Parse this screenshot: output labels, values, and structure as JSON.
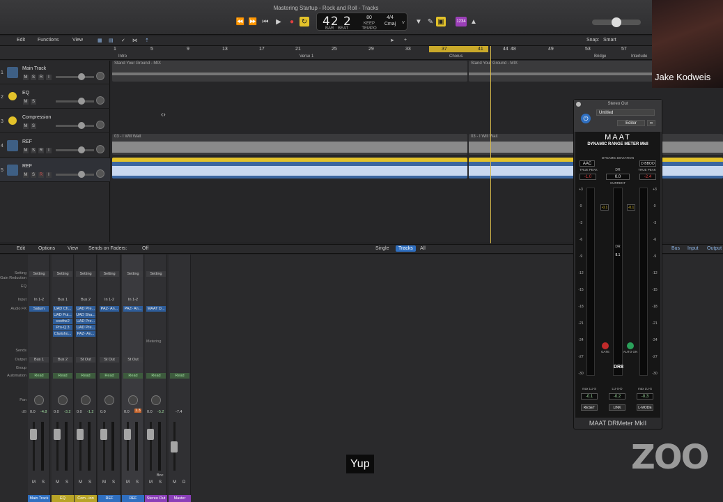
{
  "window": {
    "title": "Mastering Startup - Rock and Roll - Tracks"
  },
  "transport": {
    "bar": "42",
    "beat": "2",
    "bar_label": "BAR",
    "beat_label": "BEAT",
    "tempo": "80",
    "tempo_label": "KEEP",
    "tempo_sub": "TEMPO",
    "sig": "4/4",
    "key": "Cmaj",
    "count_in": "1234"
  },
  "toolbar": {
    "edit": "Edit",
    "functions": "Functions",
    "view": "View",
    "snap_label": "Snap:",
    "snap_value": "Smart"
  },
  "ruler": {
    "bars": [
      "1",
      "5",
      "9",
      "13",
      "17",
      "21",
      "25",
      "29",
      "33",
      "37",
      "41",
      "45",
      "49",
      "53",
      "57"
    ],
    "cycle_start": "37",
    "cycle_end": "41",
    "cycle_extra": "44",
    "cycle_extra2": "48",
    "markers": [
      "Intro",
      "Verse 1",
      "Chorus",
      "Bridge",
      "Interlude"
    ]
  },
  "tracks": [
    {
      "num": "1",
      "name": "Main Track",
      "buttons": [
        "M",
        "S",
        "R",
        "I"
      ]
    },
    {
      "num": "2",
      "name": "EQ",
      "buttons": [
        "M",
        "S"
      ]
    },
    {
      "num": "3",
      "name": "Compression",
      "buttons": [
        "M",
        "S"
      ]
    },
    {
      "num": "4",
      "name": "REF",
      "buttons": [
        "M",
        "S",
        "R",
        "I"
      ]
    },
    {
      "num": "5",
      "name": "REF",
      "buttons": [
        "M",
        "S",
        "R",
        "I"
      ]
    }
  ],
  "regions": {
    "main_a": "Stand Your Ground - MIX",
    "main_b": "Stand Your Ground - MIX",
    "ref4_a": "03 - I Will Wait",
    "ref4_b": "03 - I Will Wait",
    "ref5_a": "Stand Your Ground - MIX.1",
    "ref5_b": "Stand Your Ground - MIX.1"
  },
  "mixer_bar": {
    "edit": "Edit",
    "options": "Options",
    "view": "View",
    "sends_label": "Sends on Faders:",
    "sends_value": "Off",
    "single": "Single",
    "tracks": "Tracks",
    "all": "All",
    "bus": "Bus",
    "input": "Input",
    "output": "Output"
  },
  "mixer_labels": {
    "setting": "Setting",
    "gain": "Gain Reduction",
    "eq": "EQ",
    "input": "Input",
    "fx": "Audio FX",
    "sends": "Sends",
    "output": "Output",
    "group": "Group",
    "automation": "Automation",
    "pan": "Pan",
    "db": "dB"
  },
  "strips": [
    {
      "name": "Main Track",
      "color": "#2f6fc0",
      "input": "In 1-2",
      "fx": [
        "Saturn"
      ],
      "output": "Bus 1",
      "db1": "0.0",
      "db2": "-4.8",
      "setting": "Setting"
    },
    {
      "name": "EQ",
      "color": "#b8a427",
      "input": "Bus 1",
      "fx": [
        "UAD Ch...",
        "UAD Pul...",
        "soothe2",
        "Pro-Q 3",
        "Clarisho..."
      ],
      "output": "Bus 2",
      "db1": "0.0",
      "db2": "-3.2",
      "setting": "Setting"
    },
    {
      "name": "Com...ion",
      "color": "#b8a427",
      "input": "Bus 2",
      "fx": [
        "UAD Pre...",
        "UAD Sha...",
        "UAD Pre...",
        "UAD Pre...",
        "PAZ- An..."
      ],
      "output": "St Out",
      "db1": "0.0",
      "db2": "-1.2",
      "setting": "Setting"
    },
    {
      "name": "REF",
      "color": "#2f6fc0",
      "input": "In 1-2",
      "fx": [
        "PAZ- An..."
      ],
      "output": "St Out",
      "db1": "0.0",
      "db2": "",
      "setting": "Setting"
    },
    {
      "name": "REF",
      "color": "#2f6fc0",
      "input": "In 1-2",
      "fx": [
        "PAZ- An..."
      ],
      "output": "St Out",
      "db1": "0.0",
      "db2": "1.3",
      "setting": "Setting"
    },
    {
      "name": "Stereo Out",
      "color": "#8a3fb8",
      "input": "",
      "fx": [
        "MAAT D..."
      ],
      "output": "",
      "db1": "0.0",
      "db2": "-5.2",
      "setting": "Setting",
      "extra": "Metering",
      "bnc": "Bnc"
    },
    {
      "name": "Master",
      "color": "#8a3fb8",
      "input": "",
      "fx": [],
      "output": "",
      "db1": "-7.4",
      "db2": "",
      "setting": ""
    }
  ],
  "plugin": {
    "window_title": "Stereo Out",
    "preset": "Untitled",
    "editor": "Editor",
    "brand": "MAAT",
    "product": "DYNAMIC RANGE METER MkII",
    "dyn_dev": "DYNAMIC DEVIATION",
    "aac": "AAC",
    "dr_label": "DR",
    "dr_value": "0.0",
    "dbo": "D BBOO",
    "true_peak_l": "TRUE PEAK",
    "true_peak_r": "TRUE PEAK",
    "peak_l": "-1.0",
    "peak_r": "-2.4",
    "current": "CURRENT",
    "scale": [
      "+3",
      "0",
      "-3",
      "-6",
      "-9",
      "-12",
      "-15",
      "-18",
      "-21",
      "-24",
      "-27",
      "-30"
    ],
    "scale_r": [
      "+3",
      "0",
      "-3",
      "-6",
      "-9",
      "-12",
      "-15",
      "-18",
      "-21",
      "-24",
      "-27",
      "-30"
    ],
    "top_l": "-0.1",
    "top_r": "-0.1",
    "dr_meter": "DR",
    "dr_read": "8.1",
    "gate": "GATE",
    "auto": "AUTO ON",
    "dr8": "DR8",
    "max_lu_l": "max LU-S",
    "max_lu_c": "LU-S-D",
    "max_lu_r": "max LU-S",
    "lu_l": "-0.1",
    "lu_c": "-0.2",
    "lu_r": "-0.3",
    "reset": "RESET",
    "link": "LINK",
    "lmode": "L-MODE",
    "footer": "MAAT DRMeter MkII"
  },
  "overlay": {
    "participant": "Jake Kodweis",
    "zoom": "ZOO",
    "caption": "Yup"
  },
  "colors": {
    "accent": "#e3c22a",
    "region_blue": "#3b66a0",
    "selected": "#2f6fc0"
  }
}
